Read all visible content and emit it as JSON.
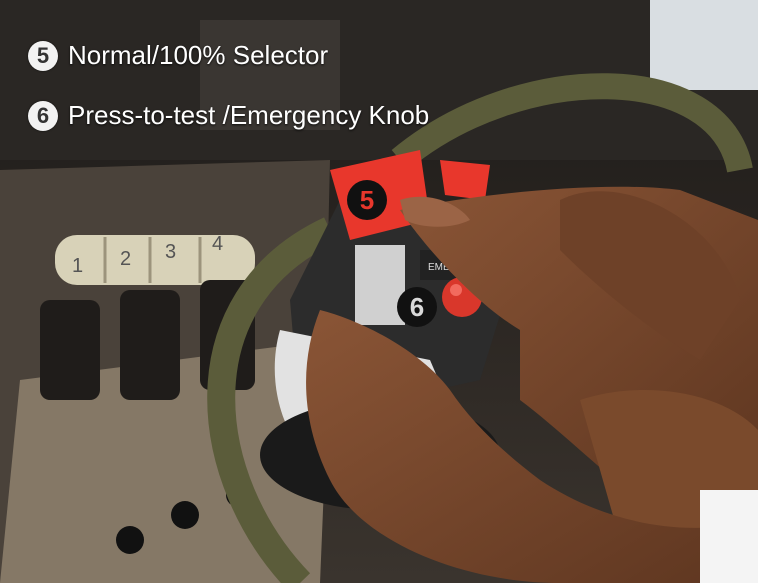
{
  "legend": [
    {
      "number": "5",
      "label": "Normal/100% Selector"
    },
    {
      "number": "6",
      "label": "Press-to-test /Emergency Knob"
    }
  ],
  "callouts": [
    {
      "number": "5"
    },
    {
      "number": "6"
    }
  ],
  "scene": {
    "throttle_labels": [
      "1",
      "2",
      "3",
      "4"
    ],
    "device_text": "EMERGENCY",
    "colors": {
      "regulator_red": "#e8372c",
      "hose_green": "#5b5c3a",
      "skin": "#7a4a2c",
      "panel": "#2b2723"
    }
  }
}
